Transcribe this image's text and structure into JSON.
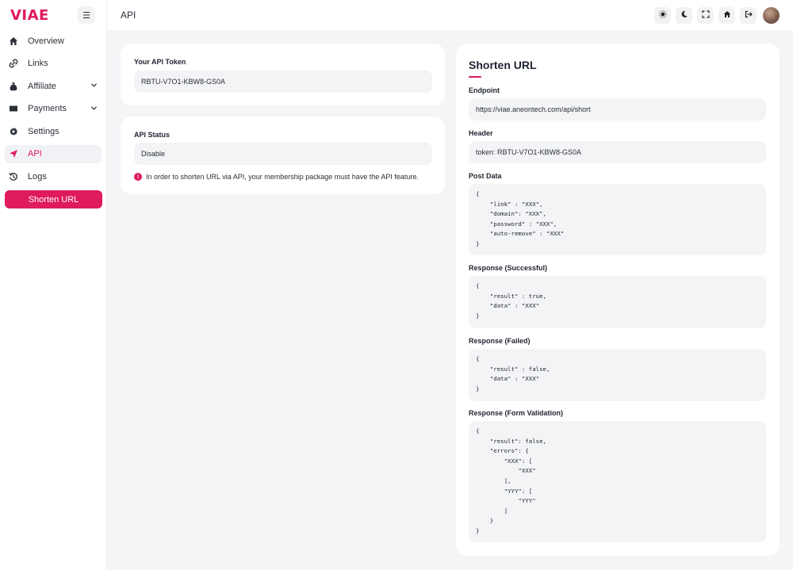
{
  "brand": {
    "name": "VIAE",
    "accent": "#e0195a"
  },
  "header": {
    "title": "API"
  },
  "sidebar": {
    "items": [
      {
        "label": "Overview",
        "icon": "home-icon"
      },
      {
        "label": "Links",
        "icon": "link-icon"
      },
      {
        "label": "Affiliate",
        "icon": "money-bag-icon",
        "expandable": true
      },
      {
        "label": "Payments",
        "icon": "card-icon",
        "expandable": true
      },
      {
        "label": "Settings",
        "icon": "gear-icon"
      },
      {
        "label": "API",
        "icon": "send-icon",
        "active": true
      },
      {
        "label": "Logs",
        "icon": "history-icon"
      }
    ],
    "cta_label": "Shorten URL"
  },
  "token_card": {
    "label": "Your API Token",
    "value": "RBTU-V7O1-KBW8-GS0A"
  },
  "status_card": {
    "label": "API Status",
    "value": "Disable",
    "notice": "In order to shorten URL via API, your membership package must have the API feature."
  },
  "shorten": {
    "title": "Shorten URL",
    "endpoint_label": "Endpoint",
    "endpoint_value": "https://viae.aneontech.com/api/short",
    "header_label": "Header",
    "header_value": "token: RBTU-V7O1-KBW8-GS0A",
    "post_label": "Post Data",
    "post_code": "{\n    \"link\" : \"XXX\",\n    \"domain\": \"XXX\",\n    \"password\" : \"XXX\",\n    \"auto-remove\" : \"XXX\"\n}",
    "success_label": "Response (Successful)",
    "success_code": "{\n    \"result\" : true,\n    \"data\" : \"XXX\"\n}",
    "failed_label": "Response (Failed)",
    "failed_code": "{\n    \"result\" : false,\n    \"data\" : \"XXX\"\n}",
    "validation_label": "Response (Form Validation)",
    "validation_code": "{\n    \"result\": false,\n    \"errors\": {\n        \"XXX\": [\n            \"XXX\"\n        ],\n        \"YYY\": [\n            \"YYY\"\n        ]\n    }\n}"
  }
}
